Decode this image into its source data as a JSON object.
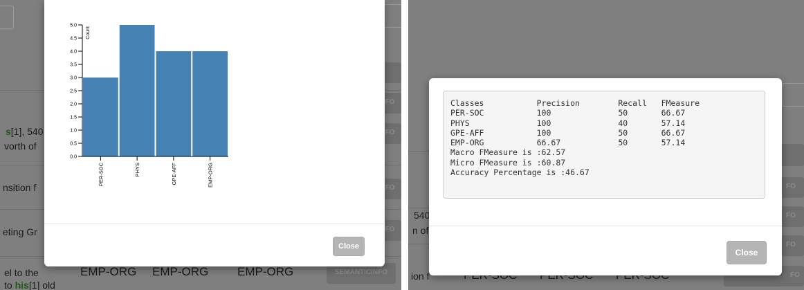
{
  "left_background": {
    "text_segments": [
      {
        "text": "s",
        "green": true
      },
      {
        "text": "[1], 540",
        "green": false
      },
      {
        "text": "vorth of",
        "green": false
      },
      {
        "text": "nsition f",
        "green": false
      },
      {
        "text": "eting Gr",
        "green": false
      },
      {
        "text": "el to the",
        "green": false
      },
      {
        "text": "EMP-ORG",
        "green": false
      },
      {
        "text": "EMP-ORG",
        "green": false
      },
      {
        "text": "EMP-ORG",
        "green": false
      },
      {
        "text": "to ",
        "green": false
      },
      {
        "text": "his",
        "green": true
      },
      {
        "text": "[1] old",
        "green": false
      }
    ],
    "buttons": [
      "NFO",
      "NFO",
      "NFO",
      "NFO",
      "SEMANTICINFO"
    ]
  },
  "right_background": {
    "text_segments": [
      "540",
      "n of",
      "ion f",
      "PER-SOC",
      "PER-SOC",
      "PER-SOC"
    ],
    "buttons": [
      "FO",
      "FO",
      "FO",
      "FO"
    ]
  },
  "histogram_modal": {
    "close_label": "Close",
    "chart_data": {
      "type": "bar",
      "categories": [
        "PER-SOC",
        "PHYS",
        "GPE-AFF",
        "EMP-ORG"
      ],
      "values": [
        3,
        5,
        4,
        4
      ],
      "ylabel": "Count",
      "ylim": [
        0,
        5
      ],
      "y_ticks": [
        "0.0",
        "0.5",
        "1.0",
        "1.5",
        "2.0",
        "2.5",
        "3.0",
        "3.5",
        "4.0",
        "4.5",
        "5.0"
      ],
      "bar_color": "#4682b4",
      "grid": false
    }
  },
  "metrics_modal": {
    "close_label": "Close",
    "headers": [
      "Classes",
      "Precision",
      "Recall",
      "FMeasure"
    ],
    "rows": [
      [
        "PER-SOC",
        "100",
        "50",
        "66.67"
      ],
      [
        "PHYS",
        "100",
        "40",
        "57.14"
      ],
      [
        "GPE-AFF",
        "100",
        "50",
        "66.67"
      ],
      [
        "EMP-ORG",
        "66.67",
        "50",
        "57.14"
      ]
    ],
    "summary": [
      "Macro FMeasure is :62.57",
      "Micro FMeasure is :60.87",
      "Accuracy Percentage is :46.67"
    ]
  },
  "colors": {
    "overlay": "#7f7f7f",
    "bar": "#4682b4",
    "green_text": "#1f5a17",
    "close_button": "#b5b5b5"
  }
}
